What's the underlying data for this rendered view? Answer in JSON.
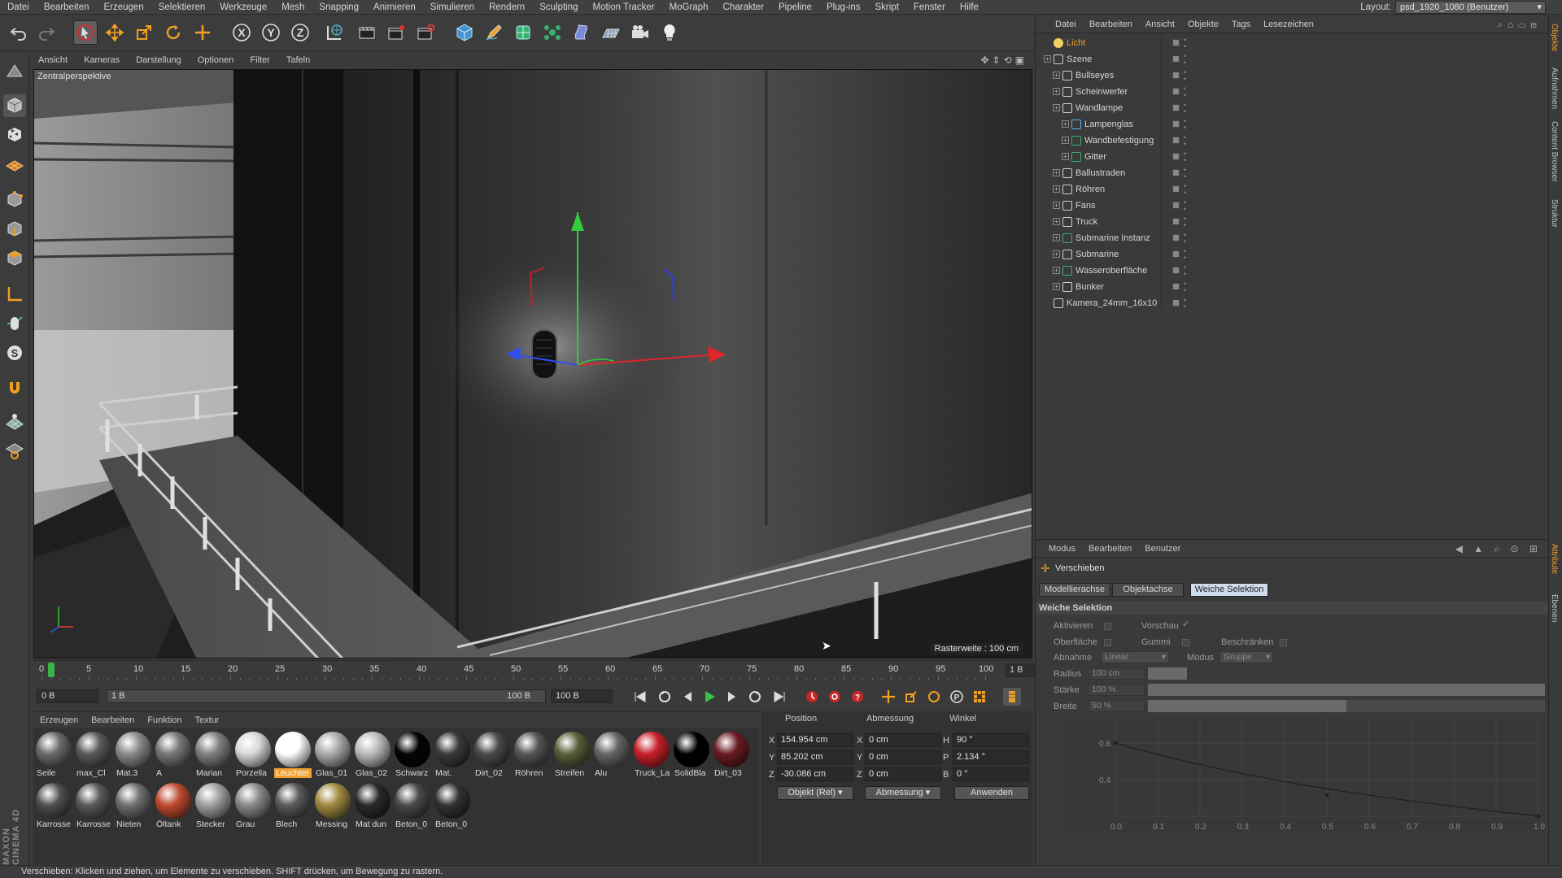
{
  "menubar": {
    "items": [
      "Datei",
      "Bearbeiten",
      "Erzeugen",
      "Selektieren",
      "Werkzeuge",
      "Mesh",
      "Snapping",
      "Animieren",
      "Simulieren",
      "Rendern",
      "Sculpting",
      "Motion Tracker",
      "MoGraph",
      "Charakter",
      "Pipeline",
      "Plug-ins",
      "Skript",
      "Fenster",
      "Hilfe"
    ],
    "layout_label": "Layout:",
    "layout_value": "psd_1920_1080 (Benutzer)"
  },
  "toolbar": {
    "icons": [
      "undo-icon",
      "redo-icon",
      "select-icon",
      "move-icon",
      "scale-icon",
      "rotate-icon",
      "last-tool-icon",
      "x-axis-icon",
      "y-axis-icon",
      "z-axis-icon",
      "world-coords-icon",
      "render-view-icon",
      "render-picture-viewer-icon",
      "render-settings-icon",
      "cube-icon",
      "pen-icon",
      "subdivision-icon",
      "mograph-cloner-icon",
      "deformer-icon",
      "floor-icon",
      "camera-icon",
      "light-icon"
    ]
  },
  "left_tools": {
    "icons": [
      "make-editable-icon",
      "model-mode-icon",
      "texture-mode-icon",
      "workplane-icon",
      "points-mode-icon",
      "edges-mode-icon",
      "polygons-mode-icon",
      "axis-mode-icon",
      "tweak-icon",
      "snap-icon",
      "magnet-icon",
      "grid-icon",
      "quantize-icon"
    ]
  },
  "viewport": {
    "menu": [
      "Ansicht",
      "Kameras",
      "Darstellung",
      "Optionen",
      "Filter",
      "Tafeln"
    ],
    "label": "Zentralperspektive",
    "grid_label": "Rasterweite : 100 cm"
  },
  "timeline": {
    "ticks": [
      "0",
      "5",
      "10",
      "15",
      "20",
      "25",
      "30",
      "35",
      "40",
      "45",
      "50",
      "55",
      "60",
      "65",
      "70",
      "75",
      "80",
      "85",
      "90",
      "95",
      "100"
    ],
    "current_frame": "1 B",
    "playhead_frame": 1
  },
  "transport": {
    "start": "0 B",
    "range_start": "1 B",
    "range_end": "100 B",
    "end": "100 B"
  },
  "materials": {
    "menu": [
      "Erzeugen",
      "Bearbeiten",
      "Funktion",
      "Textur"
    ],
    "row1": [
      {
        "name": "Seile",
        "color": "#6a6a6a"
      },
      {
        "name": "max_Cl",
        "color": "#5a5a5a"
      },
      {
        "name": "Mat.3",
        "color": "#8a8a8a"
      },
      {
        "name": "A",
        "color": "#777777"
      },
      {
        "name": "Marian",
        "color": "#808080"
      },
      {
        "name": "Porzella",
        "color": "#d8d8d8"
      },
      {
        "name": "Leuchter",
        "color": "#ffffff"
      },
      {
        "name": "Glas_01",
        "color": "#aaaaaa"
      },
      {
        "name": "Glas_02",
        "color": "#bbbbbb"
      },
      {
        "name": "Schwarz",
        "color": "#050505"
      },
      {
        "name": "Mat.",
        "color": "#3a3a3a"
      },
      {
        "name": "Dirt_02",
        "color": "#4a4a4a"
      },
      {
        "name": "Röhren",
        "color": "#555555"
      },
      {
        "name": "Streifen",
        "color": "#5a5f3a"
      },
      {
        "name": "Alu",
        "color": "#666666"
      },
      {
        "name": "Truck_La",
        "color": "#c8202a"
      },
      {
        "name": "SolidBla",
        "color": "#000000"
      },
      {
        "name": "Dirt_03",
        "color": "#6a1c22"
      }
    ],
    "row2": [
      {
        "name": "Karrosse",
        "color": "#505050"
      },
      {
        "name": "Karrosse",
        "color": "#5a5a5a"
      },
      {
        "name": "Nieten",
        "color": "#707070"
      },
      {
        "name": "Öltank",
        "color": "#c04a30"
      },
      {
        "name": "Stecker",
        "color": "#a0a0a0"
      },
      {
        "name": "Grau",
        "color": "#8a8a8a"
      },
      {
        "name": "Blech",
        "color": "#5a5a5a"
      },
      {
        "name": "Messing",
        "color": "#a08a40"
      },
      {
        "name": "Mat dun",
        "color": "#2a2a2a"
      },
      {
        "name": "Beton_0",
        "color": "#4a4a4a"
      },
      {
        "name": "Beton_0",
        "color": "#333333"
      }
    ],
    "selected": "Leuchter"
  },
  "coords": {
    "headers": [
      "Position",
      "Abmessung",
      "Winkel"
    ],
    "position": [
      {
        "axis": "X",
        "value": "154.954 cm"
      },
      {
        "axis": "Y",
        "value": "85.202 cm"
      },
      {
        "axis": "Z",
        "value": "-30.086 cm"
      }
    ],
    "size": [
      {
        "axis": "X",
        "value": "0 cm"
      },
      {
        "axis": "Y",
        "value": "0 cm"
      },
      {
        "axis": "Z",
        "value": "0 cm"
      }
    ],
    "angle": [
      {
        "axis": "H",
        "value": "90 °"
      },
      {
        "axis": "P",
        "value": "2.134 °"
      },
      {
        "axis": "B",
        "value": "0 °"
      }
    ],
    "mode": "Objekt (Rel)",
    "mode2": "Abmessung",
    "apply": "Anwenden"
  },
  "status": "Verschieben: Klicken und ziehen, um Elemente zu verschieben. SHIFT drücken, um Bewegung zu rastern.",
  "object_manager": {
    "menu": [
      "Datei",
      "Bearbeiten",
      "Ansicht",
      "Objekte",
      "Tags",
      "Lesezeichen"
    ],
    "objects": [
      {
        "name": "Licht",
        "depth": 0,
        "highlight": true,
        "type": "light"
      },
      {
        "name": "Szene",
        "depth": 0,
        "type": "null"
      },
      {
        "name": "Bullseyes",
        "depth": 1,
        "type": "null"
      },
      {
        "name": "Scheinwerfer",
        "depth": 1,
        "type": "null"
      },
      {
        "name": "Wandlampe",
        "depth": 1,
        "type": "null"
      },
      {
        "name": "Lampenglas",
        "depth": 2,
        "type": "lathe"
      },
      {
        "name": "Wandbefestigung",
        "depth": 2,
        "type": "boole"
      },
      {
        "name": "Gitter",
        "depth": 2,
        "type": "spline"
      },
      {
        "name": "Ballustraden",
        "depth": 1,
        "type": "null"
      },
      {
        "name": "Röhren",
        "depth": 1,
        "type": "null"
      },
      {
        "name": "Fans",
        "depth": 1,
        "type": "null"
      },
      {
        "name": "Truck",
        "depth": 1,
        "type": "null"
      },
      {
        "name": "Submarine Instanz",
        "depth": 1,
        "type": "instance"
      },
      {
        "name": "Submarine",
        "depth": 1,
        "type": "null"
      },
      {
        "name": "Wasseroberfläche",
        "depth": 1,
        "type": "plane"
      },
      {
        "name": "Bunker",
        "depth": 1,
        "type": "null"
      },
      {
        "name": "Kamera_24mm_16x10",
        "depth": 0,
        "type": "camera"
      }
    ]
  },
  "attribute_manager": {
    "menu": [
      "Modus",
      "Bearbeiten",
      "Benutzer"
    ],
    "tool": "Verschieben",
    "tabs": [
      "Modellierachse",
      "Objektachse",
      "Weiche Selektion"
    ],
    "active_tab": "Weiche Selektion",
    "section": "Weiche Selektion",
    "fields": {
      "aktivieren": "Aktivieren",
      "vorschau": "Vorschau",
      "oberflaeche": "Oberfläche",
      "gummi": "Gummi",
      "beschraenken": "Beschränken",
      "abnahme": "Abnahme",
      "abnahme_value": "Linear",
      "modus": "Modus",
      "modus_value": "Gruppe",
      "radius": "Radius",
      "radius_value": "100 cm",
      "staerke": "Stärke",
      "staerke_value": "100 %",
      "breite": "Breite",
      "breite_value": "50 %"
    },
    "graph": {
      "y_ticks": [
        "0.8",
        "0.4",
        "0.0"
      ],
      "x_ticks": [
        "0.0",
        "0.1",
        "0.2",
        "0.3",
        "0.4",
        "0.5",
        "0.6",
        "0.7",
        "0.8",
        "0.9",
        "1.0"
      ]
    }
  },
  "edge_tabs": [
    "Objekte",
    "Aufnahmen",
    "Content Browser",
    "Struktur",
    "Attribute",
    "Ebenen"
  ],
  "brand": "MAXON CINEMA 4D"
}
